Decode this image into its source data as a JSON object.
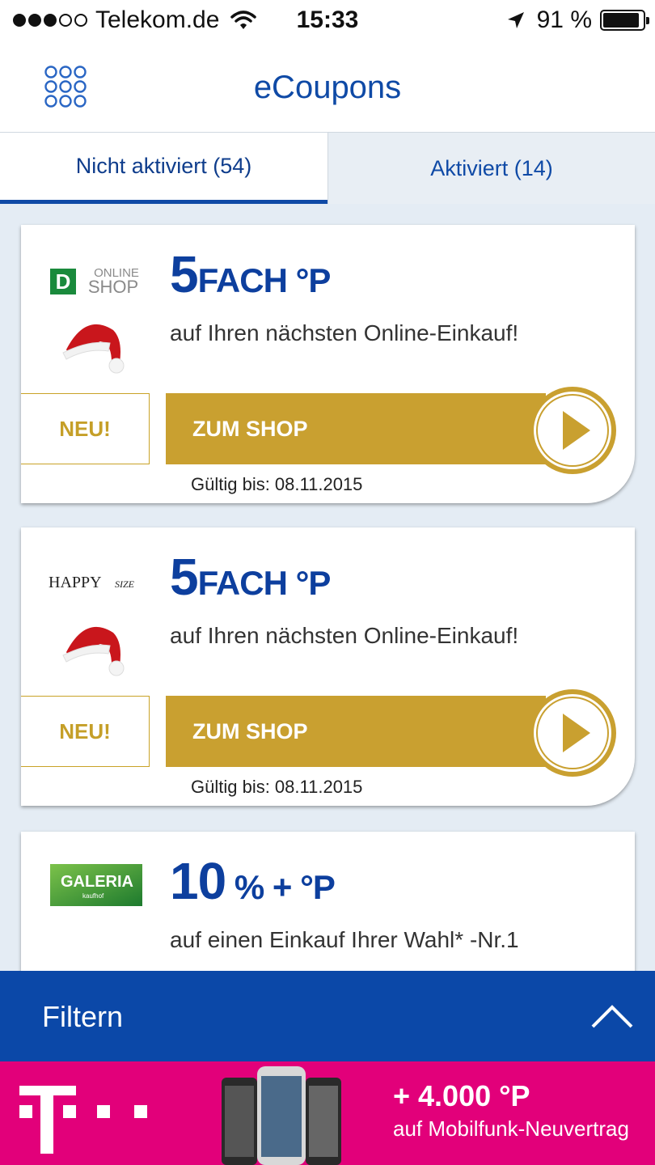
{
  "status": {
    "carrier": "Telekom.de",
    "time": "15:33",
    "battery": "91 %",
    "signal_bars": 3,
    "battery_level": 0.91
  },
  "nav": {
    "title": "eCoupons",
    "menu_icon": "grid-menu-icon"
  },
  "tabs": [
    {
      "label": "Nicht aktiviert (54)",
      "active": true
    },
    {
      "label": "Aktiviert (14)",
      "active": false
    }
  ],
  "coupons": [
    {
      "logo": "OnlineShop",
      "headline_big": "5",
      "headline_rest": "FACH °P",
      "subline": "auf Ihren nächsten Online-Einkauf!",
      "badge": "NEU!",
      "button": "ZUM SHOP",
      "valid": "Gültig bis: 08.11.2015"
    },
    {
      "logo": "HAPPY size",
      "headline_big": "5",
      "headline_rest": "FACH °P",
      "subline": "auf Ihren nächsten Online-Einkauf!",
      "badge": "NEU!",
      "button": "ZUM SHOP",
      "valid": "Gültig bis: 08.11.2015"
    },
    {
      "logo": "GALERIA Kaufhof",
      "headline_big": "10",
      "headline_rest": " % + °P",
      "subline": "auf einen Einkauf Ihrer Wahl* -Nr.1"
    }
  ],
  "filter": {
    "label": "Filtern"
  },
  "ad": {
    "headline": "+ 4.000 °P",
    "subline": "auf Mobilfunk-Neuvertrag"
  },
  "colors": {
    "primary": "#0b48a8",
    "gold": "#c9a030",
    "magenta": "#e2007a"
  }
}
